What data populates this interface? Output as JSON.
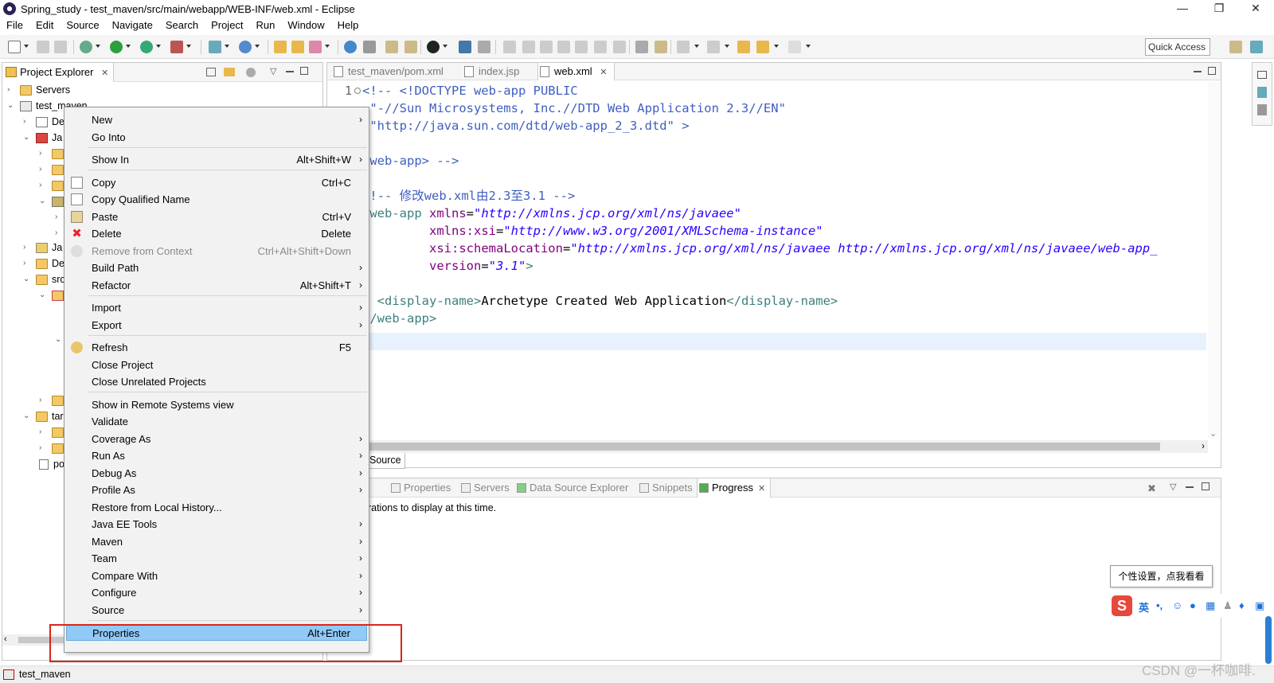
{
  "window": {
    "title": "Spring_study - test_maven/src/main/webapp/WEB-INF/web.xml - Eclipse",
    "minimize": "—",
    "restore": "❐",
    "close": "✕"
  },
  "menu": [
    "File",
    "Edit",
    "Source",
    "Navigate",
    "Search",
    "Project",
    "Run",
    "Window",
    "Help"
  ],
  "toolbar": {
    "quick_access": "Quick Access"
  },
  "project_explorer": {
    "tab_label": "Project Explorer",
    "close": "✕",
    "tree": [
      {
        "label": "Servers"
      },
      {
        "label": "test_maven"
      },
      {
        "label": "De"
      },
      {
        "label": "Ja"
      },
      {
        "label": "Ja"
      },
      {
        "label": "De"
      },
      {
        "label": "src"
      },
      {
        "label": "tar"
      },
      {
        "label": "po"
      }
    ]
  },
  "editor": {
    "tabs": [
      {
        "label": "test_maven/pom.xml",
        "active": false
      },
      {
        "label": "index.jsp",
        "active": false
      },
      {
        "label": "web.xml",
        "active": true
      }
    ],
    "line_number": "1",
    "lines": [
      {
        "cmt": "<!-- <!DOCTYPE web-app PUBLIC"
      },
      {
        "cmt": " \"-//Sun Microsystems, Inc.//DTD Web Application 2.3//EN\""
      },
      {
        "cmt": " \"http://java.sun.com/dtd/web-app_2_3.dtd\" >"
      },
      {
        "cmt": ""
      },
      {
        "cmt": "<web-app> -->"
      },
      {
        "cmt": ""
      },
      {
        "cmt": "<!-- 修改web.xml由2.3至3.1 -->"
      },
      {
        "tag": "<web-app ",
        "attr": "xmlns",
        "eq": "=",
        "val": "\"http://xmlns.jcp.org/xml/ns/javaee\""
      },
      {
        "indent": "         ",
        "attr": "xmlns:xsi",
        "eq": "=",
        "val": "\"http://www.w3.org/2001/XMLSchema-instance\""
      },
      {
        "indent": "         ",
        "attr": "xsi:schemaLocation",
        "eq": "=",
        "val": "\"http://xmlns.jcp.org/xml/ns/javaee http://xmlns.jcp.org/xml/ns/javaee/web-app_"
      },
      {
        "indent": "         ",
        "attr": "version",
        "eq": "=",
        "val": "\"3.1\"",
        "tagend": ">"
      },
      {
        "cmt": ""
      },
      {
        "indent": "  ",
        "tag": "<display-name>",
        "text": "Archetype Created Web Application",
        "tag2": "</display-name>"
      },
      {
        "tag": "</web-app>"
      }
    ],
    "source_tab": "Source"
  },
  "bottom_panel": {
    "tabs": [
      {
        "label": "kers",
        "active": false
      },
      {
        "label": "Properties",
        "active": false
      },
      {
        "label": "Servers",
        "active": false
      },
      {
        "label": "Data Source Explorer",
        "active": false
      },
      {
        "label": "Snippets",
        "active": false
      },
      {
        "label": "Progress",
        "active": true
      }
    ],
    "message": "erations to display at this time."
  },
  "context_menu": {
    "items": [
      {
        "label": "New",
        "shortcut": "",
        "submenu": true
      },
      {
        "label": "Go Into",
        "shortcut": "",
        "submenu": false
      },
      {
        "label": "Show In",
        "shortcut": "Alt+Shift+W",
        "submenu": true
      },
      {
        "label": "Copy",
        "shortcut": "Ctrl+C",
        "submenu": false
      },
      {
        "label": "Copy Qualified Name",
        "shortcut": "",
        "submenu": false
      },
      {
        "label": "Paste",
        "shortcut": "Ctrl+V",
        "submenu": false
      },
      {
        "label": "Delete",
        "shortcut": "Delete",
        "submenu": false
      },
      {
        "label": "Remove from Context",
        "shortcut": "Ctrl+Alt+Shift+Down",
        "submenu": false,
        "disabled": true
      },
      {
        "label": "Build Path",
        "shortcut": "",
        "submenu": true
      },
      {
        "label": "Refactor",
        "shortcut": "Alt+Shift+T",
        "submenu": true
      },
      {
        "label": "Import",
        "shortcut": "",
        "submenu": true
      },
      {
        "label": "Export",
        "shortcut": "",
        "submenu": true
      },
      {
        "label": "Refresh",
        "shortcut": "F5",
        "submenu": false
      },
      {
        "label": "Close Project",
        "shortcut": "",
        "submenu": false
      },
      {
        "label": "Close Unrelated Projects",
        "shortcut": "",
        "submenu": false
      },
      {
        "label": "Show in Remote Systems view",
        "shortcut": "",
        "submenu": false
      },
      {
        "label": "Validate",
        "shortcut": "",
        "submenu": false
      },
      {
        "label": "Coverage As",
        "shortcut": "",
        "submenu": true
      },
      {
        "label": "Run As",
        "shortcut": "",
        "submenu": true
      },
      {
        "label": "Debug As",
        "shortcut": "",
        "submenu": true
      },
      {
        "label": "Profile As",
        "shortcut": "",
        "submenu": true
      },
      {
        "label": "Restore from Local History...",
        "shortcut": "",
        "submenu": false
      },
      {
        "label": "Java EE Tools",
        "shortcut": "",
        "submenu": true
      },
      {
        "label": "Maven",
        "shortcut": "",
        "submenu": true
      },
      {
        "label": "Team",
        "shortcut": "",
        "submenu": true
      },
      {
        "label": "Compare With",
        "shortcut": "",
        "submenu": true
      },
      {
        "label": "Configure",
        "shortcut": "",
        "submenu": true
      },
      {
        "label": "Source",
        "shortcut": "",
        "submenu": true
      },
      {
        "label": "Properties",
        "shortcut": "Alt+Enter",
        "submenu": false,
        "selected": true
      }
    ],
    "arrow": "›"
  },
  "status": {
    "text": "test_maven"
  },
  "ime": {
    "tooltip": "个性设置，点我看看",
    "logo": "S",
    "lang": "英"
  },
  "watermark": "CSDN @一杯咖啡."
}
